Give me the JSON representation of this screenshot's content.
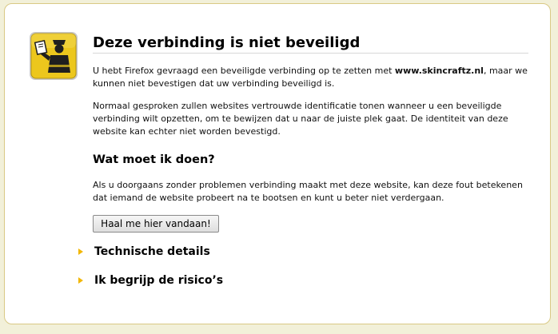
{
  "page": {
    "title": "Deze verbinding is niet beveiligd",
    "intro_before": "U hebt Firefox gevraagd een beveiligde verbinding op te zetten met ",
    "site": "www.skincraftz.nl",
    "intro_after": ", maar we kunnen niet bevestigen dat uw verbinding beveiligd is.",
    "paragraph2": "Normaal gesproken zullen websites vertrouwde identificatie tonen wanneer u een beveiligde verbinding wilt opzetten, om te bewijzen dat u naar de juiste plek gaat. De identiteit van deze website kan echter niet worden bevestigd.",
    "what_heading": "Wat moet ik doen?",
    "what_text": "Als u doorgaans zonder problemen verbinding maakt met deze website, kan deze fout betekenen dat iemand de website probeert na te bootsen en kunt u beter niet verdergaan.",
    "get_me_out_button": "Haal me hier vandaan!",
    "technical_details": "Technische details",
    "understand_risks": "Ik begrijp de risico’s"
  },
  "icons": {
    "header_icon": "security-officer-icon",
    "expander_icon": "triangle-right-icon"
  },
  "colors": {
    "page_background": "#f2f0d9",
    "card_border": "#d9c985",
    "icon_yellow": "#e8c51c",
    "expander_arrow": "#f2b705"
  }
}
